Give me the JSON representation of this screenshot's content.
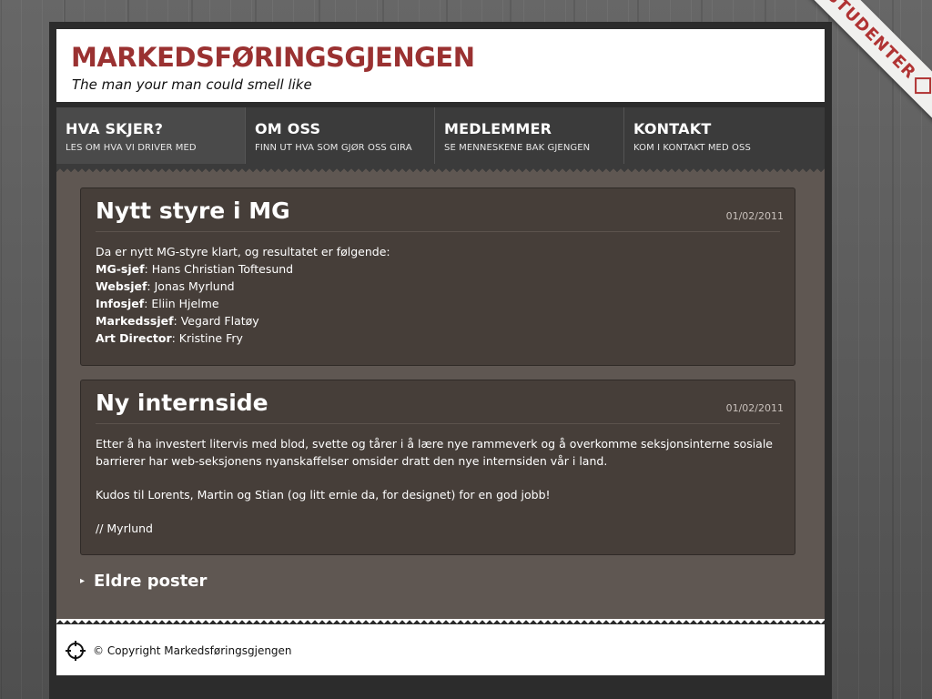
{
  "header": {
    "site_title": "MARKEDSFØRINGSGJENGEN",
    "tagline": "The man your man could smell like"
  },
  "ribbon": {
    "label": "STUDENTER"
  },
  "nav": {
    "items": [
      {
        "label": "HVA SKJER?",
        "sub": "LES OM HVA VI DRIVER MED"
      },
      {
        "label": "OM OSS",
        "sub": "FINN UT HVA SOM GJØR OSS GIRA"
      },
      {
        "label": "MEDLEMMER",
        "sub": "SE MENNESKENE BAK GJENGEN"
      },
      {
        "label": "KONTAKT",
        "sub": "KOM I KONTAKT MED OSS"
      }
    ]
  },
  "posts": [
    {
      "title": "Nytt styre i MG",
      "date": "01/02/2011",
      "intro": "Da er nytt MG-styre klart, og resultatet er følgende:",
      "roles": [
        {
          "role": "MG-sjef",
          "name": ": Hans Christian Toftesund"
        },
        {
          "role": "Websjef",
          "name": ": Jonas Myrlund"
        },
        {
          "role": "Infosjef",
          "name": ": Eliin Hjelme"
        },
        {
          "role": "Markedssjef",
          "name": ": Vegard Flatøy"
        },
        {
          "role": "Art Director",
          "name": ": Kristine Fry"
        }
      ]
    },
    {
      "title": "Ny internside",
      "date": "01/02/2011",
      "p1": "Etter å ha investert litervis med blod, svette og tårer i å lære nye rammeverk og å overkomme seksjonsinterne sosiale barrierer har web-seksjonens nyanskaffelser omsider dratt den nye internsiden vår i land.",
      "p2": "Kudos til Lorents, Martin og Stian (og litt ernie da, for designet) for en god jobb!",
      "p3": "// Myrlund"
    }
  ],
  "older_link": "Eldre poster",
  "footer": {
    "copyright": "© Copyright Markedsføringsgjengen"
  },
  "colors": {
    "brand": "#9a3131",
    "post_bg": "#463e39",
    "content_bg": "#5f5752"
  }
}
